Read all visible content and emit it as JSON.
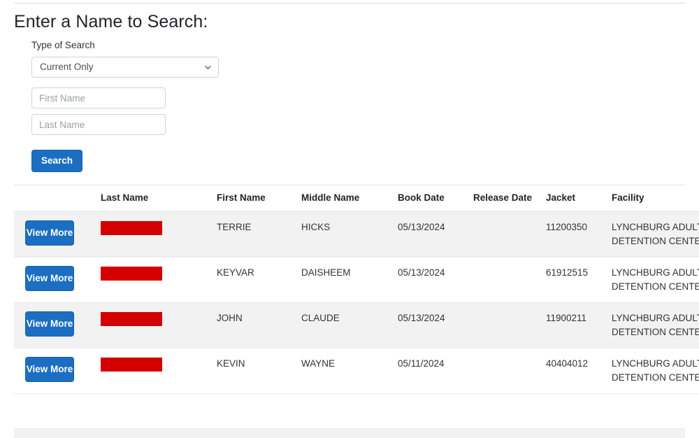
{
  "search": {
    "title": "Enter a Name to Search:",
    "type_label": "Type of Search",
    "type_selected": "Current Only",
    "type_options": [
      "Current Only"
    ],
    "first_name_placeholder": "First Name",
    "first_name_value": "",
    "last_name_placeholder": "Last Name",
    "last_name_value": "",
    "search_button": "Search"
  },
  "table": {
    "headers": {
      "action": "",
      "last_name": "Last Name",
      "first_name": "First Name",
      "middle_name": "Middle Name",
      "book_date": "Book Date",
      "release_date": "Release Date",
      "jacket": "Jacket",
      "facility": "Facility"
    },
    "view_more_label": "View More",
    "rows": [
      {
        "last_name": "",
        "first_name": "TERRIE",
        "middle_name": "HICKS",
        "book_date": "05/13/2024",
        "release_date": "",
        "jacket": "11200350",
        "facility_line1": "LYNCHBURG ADULT",
        "facility_line2": "DETENTION CENTER"
      },
      {
        "last_name": "",
        "first_name": "KEYVAR",
        "middle_name": "DAISHEEM",
        "book_date": "05/13/2024",
        "release_date": "",
        "jacket": "61912515",
        "facility_line1": "LYNCHBURG ADULT",
        "facility_line2": "DETENTION CENTER"
      },
      {
        "last_name": "",
        "first_name": "JOHN",
        "middle_name": "CLAUDE",
        "book_date": "05/13/2024",
        "release_date": "",
        "jacket": "11900211",
        "facility_line1": "LYNCHBURG ADULT",
        "facility_line2": "DETENTION CENTER"
      },
      {
        "last_name": "",
        "first_name": "KEVIN",
        "middle_name": "WAYNE",
        "book_date": "05/11/2024",
        "release_date": "",
        "jacket": "40404012",
        "facility_line1": "LYNCHBURG ADULT",
        "facility_line2": "DETENTION CENTER"
      }
    ]
  },
  "colors": {
    "primary_blue": "#1b6ec2",
    "redaction_red": "#d40000",
    "row_stripe": "#f2f2f2",
    "border": "#e3e3e3"
  }
}
